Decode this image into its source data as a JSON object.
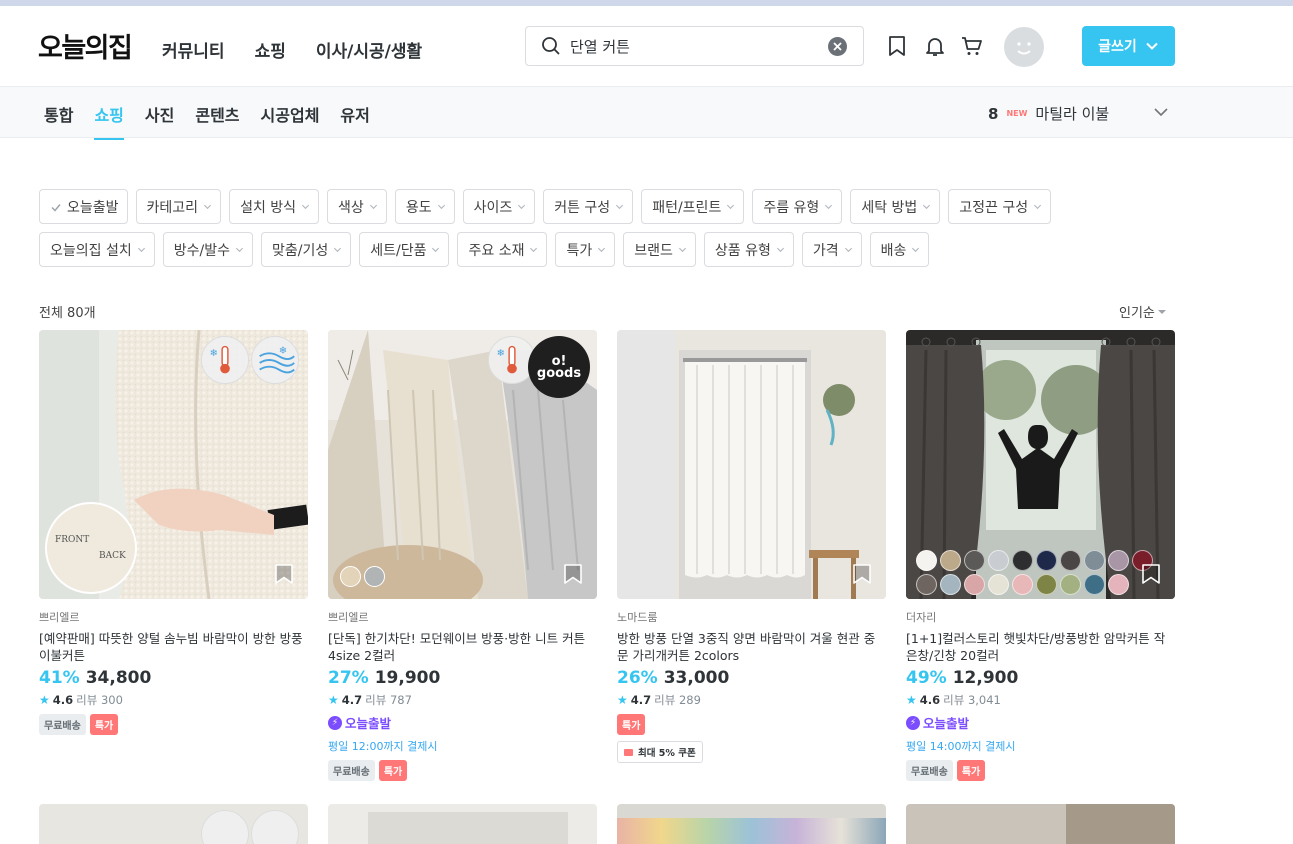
{
  "header": {
    "logo": "오늘의집",
    "nav": [
      "커뮤니티",
      "쇼핑",
      "이사/시공/생활"
    ],
    "search_value": "단열 커튼",
    "write_label": "글쓰기"
  },
  "tabs": {
    "items": [
      "통합",
      "쇼핑",
      "사진",
      "콘텐츠",
      "시공업체",
      "유저"
    ],
    "active": "쇼핑"
  },
  "ranking": {
    "number": "8",
    "new_label": "NEW",
    "keyword": "마틸라 이불"
  },
  "filters": {
    "row1": [
      "오늘출발",
      "카테고리",
      "설치 방식",
      "색상",
      "용도",
      "사이즈",
      "커튼 구성",
      "패턴/프린트",
      "주름 유형",
      "세탁 방법",
      "고정끈 구성"
    ],
    "row2": [
      "오늘의집 설치",
      "방수/발수",
      "맞춤/기성",
      "세트/단품",
      "주요 소재",
      "특가",
      "브랜드",
      "상품 유형",
      "가격",
      "배송"
    ]
  },
  "results": {
    "total": "전체 80개",
    "sort": "인기순"
  },
  "products": [
    {
      "brand": "쁘리엘르",
      "name": "[예약판매] 따뜻한 양털 솜누빔 바람막이 방한 방풍 이불커튼",
      "discount": "41%",
      "price": "34,800",
      "rating": "4.6",
      "reviews": "리뷰 300",
      "fast": "",
      "deadline": "",
      "tag_free": "무료배송",
      "tag_sale": "특가",
      "coupon": "",
      "thumb_text_front": "FRONT",
      "thumb_text_back": "BACK"
    },
    {
      "brand": "쁘리엘르",
      "name": "[단독] 한기차단! 모던웨이브 방풍·방한 니트 커튼 4size 2컬러",
      "discount": "27%",
      "price": "19,900",
      "rating": "4.7",
      "reviews": "리뷰 787",
      "fast": "오늘출발",
      "deadline": "평일 12:00까지 결제시",
      "tag_free": "무료배송",
      "tag_sale": "특가",
      "coupon": "",
      "thumb_logo": "o! goods"
    },
    {
      "brand": "노마드룸",
      "name": "방한 방풍 단열 3중직 양면 바람막이 겨울 현관 중문 가리개커튼 2colors",
      "discount": "26%",
      "price": "33,000",
      "rating": "4.7",
      "reviews": "리뷰 289",
      "fast": "",
      "deadline": "",
      "tag_free": "",
      "tag_sale": "특가",
      "coupon": "최대 5% 쿠폰"
    },
    {
      "brand": "더자리",
      "name": "[1+1]컬러스토리 햇빛차단/방풍방한 암막커튼 작은창/긴창 20컬러",
      "discount": "49%",
      "price": "12,900",
      "rating": "4.6",
      "reviews": "리뷰 3,041",
      "fast": "오늘출발",
      "deadline": "평일 14:00까지 결제시",
      "tag_free": "무료배송",
      "tag_sale": "특가",
      "coupon": ""
    }
  ],
  "colors": {
    "accent": "#35c5f0",
    "fast": "#7c4dff",
    "sale": "#ff7777",
    "swatches": [
      "#f4f3f0",
      "#bca98a",
      "#5b5a59",
      "#c9ccd0",
      "#2e2e30",
      "#1e2848",
      "#4b4646",
      "#7e8d96",
      "#a895a6",
      "#7a1d2b",
      "#6e6560",
      "#a4b5bf",
      "#d9a6a8",
      "#e5e3d6",
      "#e8b7b8",
      "#7e8445",
      "#a3b182",
      "#3f6f86",
      "#e5b3bb"
    ]
  }
}
